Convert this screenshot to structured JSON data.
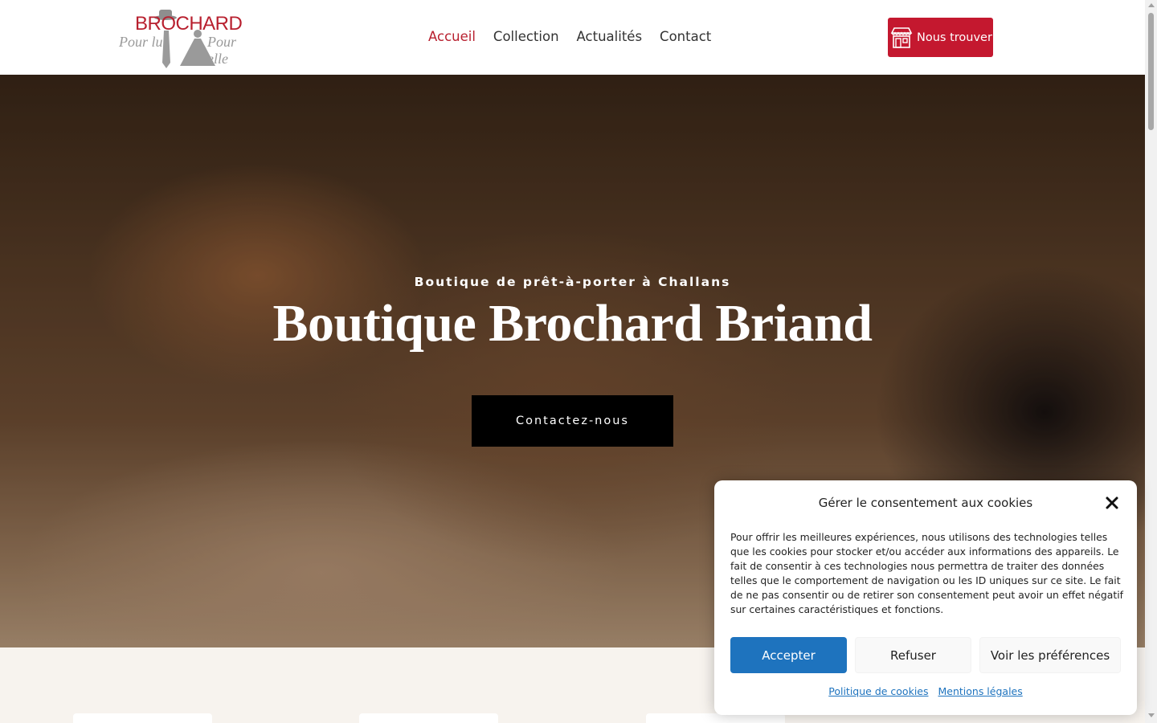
{
  "header": {
    "logo": {
      "brand": "BROCHARD",
      "sub_left": "Pour lui",
      "sub_right": "Pour elle"
    },
    "nav": [
      {
        "label": "Accueil",
        "active": true
      },
      {
        "label": "Collection",
        "active": false
      },
      {
        "label": "Actualités",
        "active": false
      },
      {
        "label": "Contact",
        "active": false
      }
    ],
    "find_button": {
      "label": "Nous trouver",
      "icon": "shop-icon"
    }
  },
  "hero": {
    "subtitle": "Boutique de prêt-à-porter à Challans",
    "title": "Boutique Brochard Briand",
    "cta_label": "Contactez-nous"
  },
  "cookie_banner": {
    "title": "Gérer le consentement aux cookies",
    "text": "Pour offrir les meilleures expériences, nous utilisons des technologies telles que les cookies pour stocker et/ou accéder aux informations des appareils. Le fait de consentir à ces technologies nous permettra de traiter des données telles que le comportement de navigation ou les ID uniques sur ce site. Le fait de ne pas consentir ou de retirer son consentement peut avoir un effet négatif sur certaines caractéristiques et fonctions.",
    "accept_label": "Accepter",
    "refuse_label": "Refuser",
    "prefs_label": "Voir les préférences",
    "links": [
      "Politique de cookies",
      "Mentions légales"
    ]
  },
  "colors": {
    "brand_red": "#c4182f",
    "accept_blue": "#1e73be",
    "hero_button": "#000000",
    "section_bg": "#f7f3ee"
  }
}
